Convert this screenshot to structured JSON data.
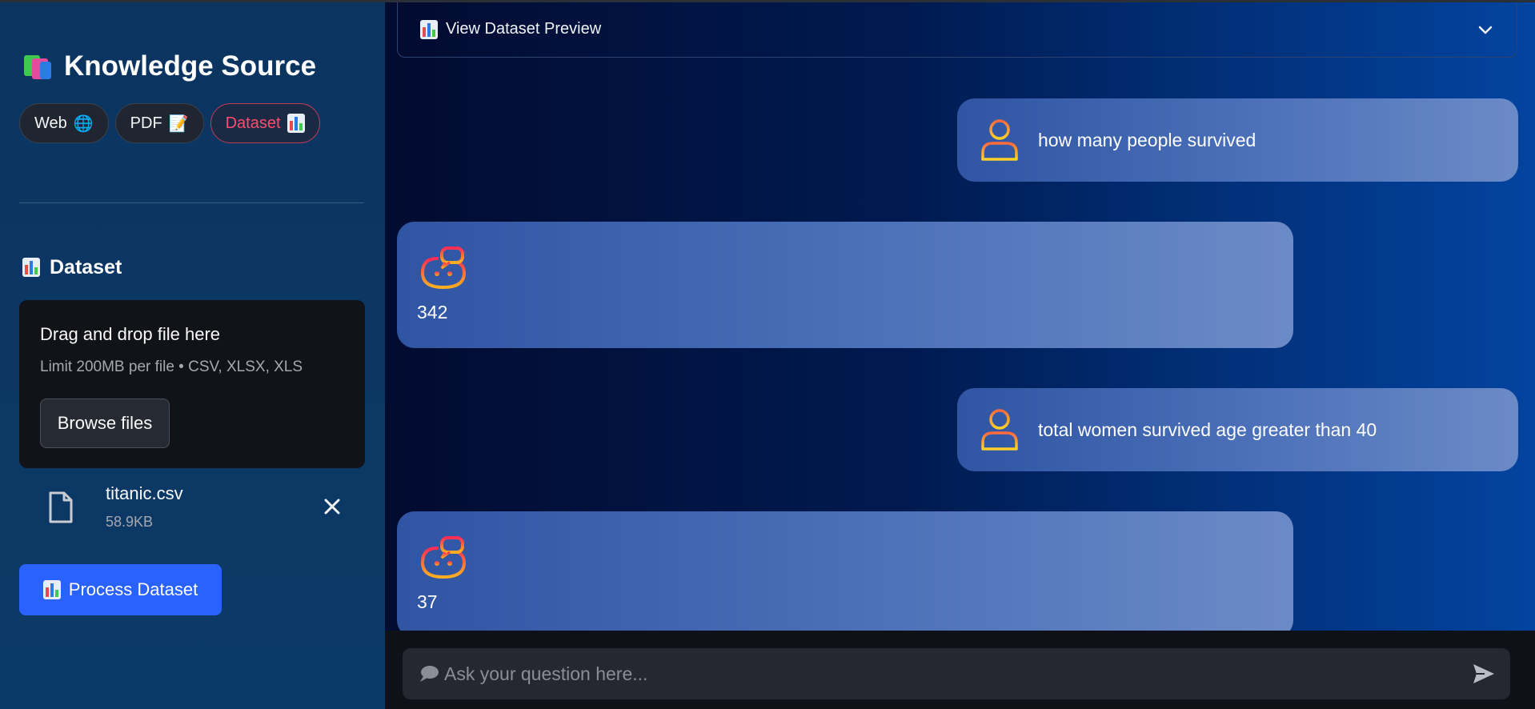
{
  "sidebar": {
    "title": "Knowledge Source",
    "tabs": [
      {
        "label": "Web",
        "emoji": "🌐"
      },
      {
        "label": "PDF",
        "emoji": "📝"
      },
      {
        "label": "Dataset",
        "emoji": ""
      }
    ],
    "section_title": "Dataset",
    "uploader": {
      "title": "Drag and drop file here",
      "limit": "Limit 200MB per file • CSV, XLSX, XLS",
      "browse_label": "Browse files"
    },
    "file": {
      "name": "titanic.csv",
      "size": "58.9KB"
    },
    "process_label": "Process Dataset"
  },
  "main": {
    "expander_label": "View Dataset Preview",
    "messages": [
      {
        "role": "user",
        "text": "how many people survived"
      },
      {
        "role": "assistant",
        "text": "342"
      },
      {
        "role": "user",
        "text": "total women survived age greater than 40"
      },
      {
        "role": "assistant",
        "text": "37"
      }
    ]
  },
  "chat_input": {
    "placeholder": "Ask your question here..."
  },
  "colors": {
    "sidebar_bg": "#0c3560",
    "accent_active": "#ff4b6e",
    "primary_button": "#2962ff",
    "avatar_user": "#f6a623",
    "avatar_bot": "#ff6a1a"
  }
}
